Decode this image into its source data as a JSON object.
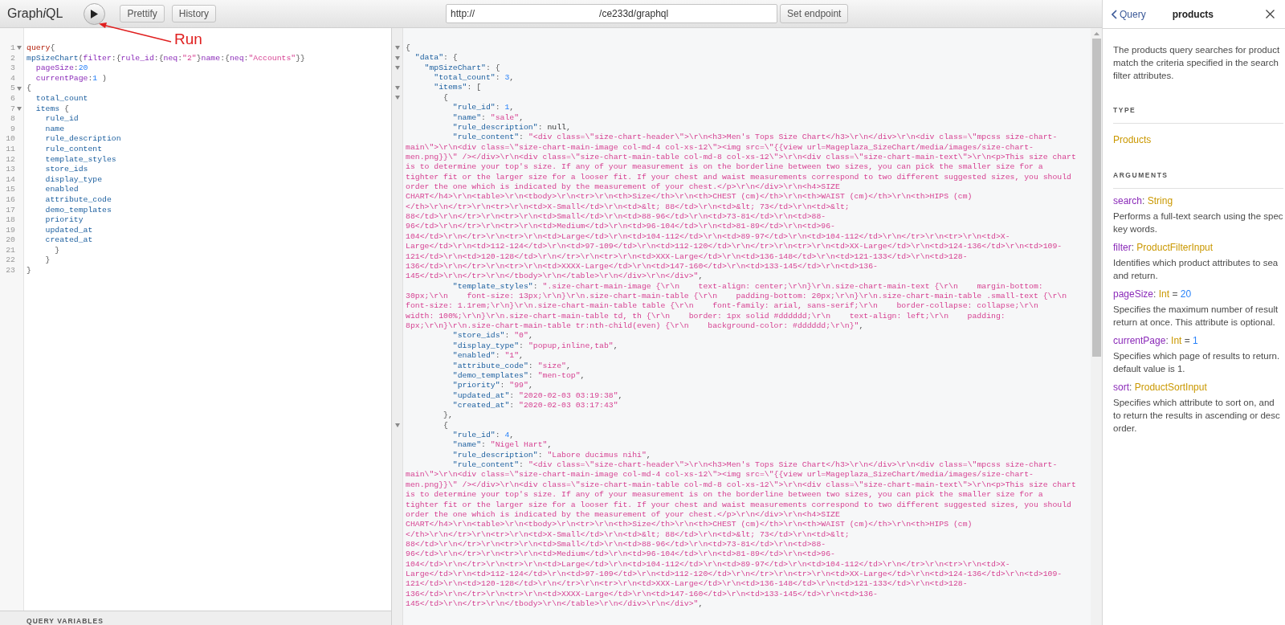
{
  "toolbar": {
    "title": [
      {
        "text": "Graph",
        "italic": false
      },
      {
        "text": "i",
        "italic": true
      },
      {
        "text": "QL",
        "italic": false
      }
    ],
    "buttons": [
      "Prettify",
      "History"
    ],
    "url": {
      "value": [
        "http://",
        "/ce233d/graphql"
      ]
    },
    "endpoint_button": "Set endpoint"
  },
  "annotation": {
    "label": "Run"
  },
  "query_editor": {
    "lines": [
      {
        "number": "1",
        "foldable": true,
        "tokens": [
          {
            "kind": "kw",
            "text": "query"
          },
          {
            "kind": "p",
            "text": "{"
          }
        ]
      },
      {
        "number": "2",
        "foldable": false,
        "tokens": [
          {
            "kind": "f",
            "text": "mpSizeChart"
          },
          {
            "kind": "p",
            "text": "("
          },
          {
            "kind": "a",
            "text": "filter"
          },
          {
            "kind": "p",
            "text": ":{"
          },
          {
            "kind": "a",
            "text": "rule_id"
          },
          {
            "kind": "p",
            "text": ":{"
          },
          {
            "kind": "a",
            "text": "neq"
          },
          {
            "kind": "p",
            "text": ":"
          },
          {
            "kind": "s",
            "text": "\"2\""
          },
          {
            "kind": "p",
            "text": "}"
          },
          {
            "kind": "a",
            "text": "name"
          },
          {
            "kind": "p",
            "text": ":{"
          },
          {
            "kind": "a",
            "text": "neq"
          },
          {
            "kind": "p",
            "text": ":"
          },
          {
            "kind": "s",
            "text": "\"Accounts\""
          },
          {
            "kind": "p",
            "text": "}}"
          }
        ]
      },
      {
        "number": "3",
        "foldable": false,
        "tokens": [
          {
            "kind": "a",
            "text": "  pageSize"
          },
          {
            "kind": "p",
            "text": ":"
          },
          {
            "kind": "n",
            "text": "20"
          }
        ]
      },
      {
        "number": "4",
        "foldable": false,
        "tokens": [
          {
            "kind": "a",
            "text": "  currentPage"
          },
          {
            "kind": "p",
            "text": ":"
          },
          {
            "kind": "n",
            "text": "1"
          },
          {
            "kind": "p",
            "text": " )"
          }
        ]
      },
      {
        "number": "5",
        "foldable": true,
        "tokens": [
          {
            "kind": "p",
            "text": "{"
          }
        ]
      },
      {
        "number": "6",
        "foldable": false,
        "tokens": [
          {
            "kind": "f",
            "text": "  total_count"
          }
        ]
      },
      {
        "number": "7",
        "foldable": true,
        "tokens": [
          {
            "kind": "f",
            "text": "  items"
          },
          {
            "kind": "p",
            "text": " {"
          }
        ]
      },
      {
        "number": "8",
        "foldable": false,
        "tokens": [
          {
            "kind": "f",
            "text": "    rule_id"
          }
        ]
      },
      {
        "number": "9",
        "foldable": false,
        "tokens": [
          {
            "kind": "f",
            "text": "    name"
          }
        ]
      },
      {
        "number": "10",
        "foldable": false,
        "tokens": [
          {
            "kind": "f",
            "text": "    rule_description"
          }
        ]
      },
      {
        "number": "11",
        "foldable": false,
        "tokens": [
          {
            "kind": "f",
            "text": "    rule_content"
          }
        ]
      },
      {
        "number": "12",
        "foldable": false,
        "tokens": [
          {
            "kind": "f",
            "text": "    template_styles"
          }
        ]
      },
      {
        "number": "13",
        "foldable": false,
        "tokens": [
          {
            "kind": "f",
            "text": "    store_ids"
          }
        ]
      },
      {
        "number": "14",
        "foldable": false,
        "tokens": [
          {
            "kind": "f",
            "text": "    display_type"
          }
        ]
      },
      {
        "number": "15",
        "foldable": false,
        "tokens": [
          {
            "kind": "f",
            "text": "    enabled"
          }
        ]
      },
      {
        "number": "16",
        "foldable": false,
        "tokens": [
          {
            "kind": "f",
            "text": "    attribute_code"
          }
        ]
      },
      {
        "number": "17",
        "foldable": false,
        "tokens": [
          {
            "kind": "f",
            "text": "    demo_templates"
          }
        ]
      },
      {
        "number": "18",
        "foldable": false,
        "tokens": [
          {
            "kind": "f",
            "text": "    priority"
          }
        ]
      },
      {
        "number": "19",
        "foldable": false,
        "tokens": [
          {
            "kind": "f",
            "text": "    updated_at"
          }
        ]
      },
      {
        "number": "20",
        "foldable": false,
        "tokens": [
          {
            "kind": "f",
            "text": "    created_at"
          }
        ]
      },
      {
        "number": "21",
        "foldable": false,
        "tokens": [
          {
            "kind": "p",
            "text": "      }"
          }
        ]
      },
      {
        "number": "22",
        "foldable": false,
        "tokens": [
          {
            "kind": "p",
            "text": "    }"
          }
        ]
      },
      {
        "number": "23",
        "foldable": false,
        "tokens": [
          {
            "kind": "p",
            "text": "}"
          }
        ]
      }
    ],
    "variables_title": "QUERY VARIABLES"
  },
  "result": {
    "lines": [
      {
        "foldable": true,
        "tokens": [
          {
            "kind": "p",
            "text": "{"
          }
        ]
      },
      {
        "foldable": true,
        "tokens": [
          {
            "kind": "k",
            "text": "  \"data\""
          },
          {
            "kind": "p",
            "text": ": {"
          }
        ]
      },
      {
        "foldable": true,
        "tokens": [
          {
            "kind": "k",
            "text": "    \"mpSizeChart\""
          },
          {
            "kind": "p",
            "text": ": {"
          }
        ]
      },
      {
        "foldable": false,
        "tokens": [
          {
            "kind": "k",
            "text": "      \"total_count\""
          },
          {
            "kind": "p",
            "text": ": "
          },
          {
            "kind": "n",
            "text": "3"
          },
          {
            "kind": "p",
            "text": ","
          }
        ]
      },
      {
        "foldable": true,
        "tokens": [
          {
            "kind": "k",
            "text": "      \"items\""
          },
          {
            "kind": "p",
            "text": ": ["
          }
        ]
      },
      {
        "foldable": true,
        "tokens": [
          {
            "kind": "p",
            "text": "        {"
          }
        ]
      },
      {
        "foldable": false,
        "tokens": [
          {
            "kind": "k",
            "text": "          \"rule_id\""
          },
          {
            "kind": "p",
            "text": ": "
          },
          {
            "kind": "n",
            "text": "1"
          },
          {
            "kind": "p",
            "text": ","
          }
        ]
      },
      {
        "foldable": false,
        "tokens": [
          {
            "kind": "k",
            "text": "          \"name\""
          },
          {
            "kind": "p",
            "text": ": "
          },
          {
            "kind": "s",
            "text": "\"sale\""
          },
          {
            "kind": "p",
            "text": ","
          }
        ]
      },
      {
        "foldable": false,
        "tokens": [
          {
            "kind": "k",
            "text": "          \"rule_description\""
          },
          {
            "kind": "p",
            "text": ": "
          },
          {
            "kind": "x",
            "text": "null"
          },
          {
            "kind": "p",
            "text": ","
          }
        ]
      },
      {
        "foldable": false,
        "tokens": [
          {
            "kind": "k",
            "text": "          \"rule_content\""
          },
          {
            "kind": "p",
            "text": ": "
          },
          {
            "kind": "s",
            "text": "\"<div class=\\\"size-chart-header\\\">\\r\\n<h3>Men's Tops Size Chart</h3>\\r\\n</div>\\r\\n<div class=\\\"mpcss size-chart-"
          }
        ]
      },
      {
        "foldable": false,
        "tokens": [
          {
            "kind": "s",
            "text": "main\\\">\\r\\n<div class=\\\"size-chart-main-image col-md-4 col-xs-12\\\"><img src=\\\"{{view url=Mageplaza_SizeChart/media/images/size-chart-"
          }
        ]
      },
      {
        "foldable": false,
        "tokens": [
          {
            "kind": "s",
            "text": "men.png}}\\\" /></div>\\r\\n<div class=\\\"size-chart-main-table col-md-8 col-xs-12\\\">\\r\\n<div class=\\\"size-chart-main-text\\\">\\r\\n<p>This size chart"
          }
        ]
      },
      {
        "foldable": false,
        "tokens": [
          {
            "kind": "s",
            "text": "is to determine your top's size. If any of your measurement is on the borderline between two sizes, you can pick the smaller size for a"
          }
        ]
      },
      {
        "foldable": false,
        "tokens": [
          {
            "kind": "s",
            "text": "tighter fit or the larger size for a looser fit. If your chest and waist measurements correspond to two different suggested sizes, you should"
          }
        ]
      },
      {
        "foldable": false,
        "tokens": [
          {
            "kind": "s",
            "text": "order the one which is indicated by the measurement of your chest.</p>\\r\\n</div>\\r\\n<h4>SIZE"
          }
        ]
      },
      {
        "foldable": false,
        "tokens": [
          {
            "kind": "s",
            "text": "CHART</h4>\\r\\n<table>\\r\\n<tbody>\\r\\n<tr>\\r\\n<th>Size</th>\\r\\n<th>CHEST (cm)</th>\\r\\n<th>WAIST (cm)</th>\\r\\n<th>HIPS (cm)"
          }
        ]
      },
      {
        "foldable": false,
        "tokens": [
          {
            "kind": "s",
            "text": "</th>\\r\\n</tr>\\r\\n<tr>\\r\\n<td>X-Small</td>\\r\\n<td>&lt; 88</td>\\r\\n<td>&lt; 73</td>\\r\\n<td>&lt;"
          }
        ]
      },
      {
        "foldable": false,
        "tokens": [
          {
            "kind": "s",
            "text": "88</td>\\r\\n</tr>\\r\\n<tr>\\r\\n<td>Small</td>\\r\\n<td>88-96</td>\\r\\n<td>73-81</td>\\r\\n<td>88-"
          }
        ]
      },
      {
        "foldable": false,
        "tokens": [
          {
            "kind": "s",
            "text": "96</td>\\r\\n</tr>\\r\\n<tr>\\r\\n<td>Medium</td>\\r\\n<td>96-104</td>\\r\\n<td>81-89</td>\\r\\n<td>96-"
          }
        ]
      },
      {
        "foldable": false,
        "tokens": [
          {
            "kind": "s",
            "text": "104</td>\\r\\n</tr>\\r\\n<tr>\\r\\n<td>Large</td>\\r\\n<td>104-112</td>\\r\\n<td>89-97</td>\\r\\n<td>104-112</td>\\r\\n</tr>\\r\\n<tr>\\r\\n<td>X-"
          }
        ]
      },
      {
        "foldable": false,
        "tokens": [
          {
            "kind": "s",
            "text": "Large</td>\\r\\n<td>112-124</td>\\r\\n<td>97-109</td>\\r\\n<td>112-120</td>\\r\\n</tr>\\r\\n<tr>\\r\\n<td>XX-Large</td>\\r\\n<td>124-136</td>\\r\\n<td>109-"
          }
        ]
      },
      {
        "foldable": false,
        "tokens": [
          {
            "kind": "s",
            "text": "121</td>\\r\\n<td>120-128</td>\\r\\n</tr>\\r\\n<tr>\\r\\n<td>XXX-Large</td>\\r\\n<td>136-148</td>\\r\\n<td>121-133</td>\\r\\n<td>128-"
          }
        ]
      },
      {
        "foldable": false,
        "tokens": [
          {
            "kind": "s",
            "text": "136</td>\\r\\n</tr>\\r\\n<tr>\\r\\n<td>XXXX-Large</td>\\r\\n<td>147-160</td>\\r\\n<td>133-145</td>\\r\\n<td>136-"
          }
        ]
      },
      {
        "foldable": false,
        "tokens": [
          {
            "kind": "s",
            "text": "145</td>\\r\\n</tr>\\r\\n</tbody>\\r\\n</table>\\r\\n</div>\\r\\n</div>\""
          },
          {
            "kind": "p",
            "text": ","
          }
        ]
      },
      {
        "foldable": false,
        "tokens": [
          {
            "kind": "k",
            "text": "          \"template_styles\""
          },
          {
            "kind": "p",
            "text": ": "
          },
          {
            "kind": "s",
            "text": "\".size-chart-main-image {\\r\\n    text-align: center;\\r\\n}\\r\\n.size-chart-main-text {\\r\\n    margin-bottom:"
          }
        ]
      },
      {
        "foldable": false,
        "tokens": [
          {
            "kind": "s",
            "text": "30px;\\r\\n    font-size: 13px;\\r\\n}\\r\\n.size-chart-main-table {\\r\\n    padding-bottom: 20px;\\r\\n}\\r\\n.size-chart-main-table .small-text {\\r\\n"
          }
        ]
      },
      {
        "foldable": false,
        "tokens": [
          {
            "kind": "s",
            "text": "font-size: 1.1rem;\\r\\n}\\r\\n.size-chart-main-table table {\\r\\n    font-family: arial, sans-serif;\\r\\n    border-collapse: collapse;\\r\\n"
          }
        ]
      },
      {
        "foldable": false,
        "tokens": [
          {
            "kind": "s",
            "text": "width: 100%;\\r\\n}\\r\\n.size-chart-main-table td, th {\\r\\n    border: 1px solid #dddddd;\\r\\n    text-align: left;\\r\\n    padding:"
          }
        ]
      },
      {
        "foldable": false,
        "tokens": [
          {
            "kind": "s",
            "text": "8px;\\r\\n}\\r\\n.size-chart-main-table tr:nth-child(even) {\\r\\n    background-color: #dddddd;\\r\\n}\""
          },
          {
            "kind": "p",
            "text": ","
          }
        ]
      },
      {
        "foldable": false,
        "tokens": [
          {
            "kind": "k",
            "text": "          \"store_ids\""
          },
          {
            "kind": "p",
            "text": ": "
          },
          {
            "kind": "s",
            "text": "\"0\""
          },
          {
            "kind": "p",
            "text": ","
          }
        ]
      },
      {
        "foldable": false,
        "tokens": [
          {
            "kind": "k",
            "text": "          \"display_type\""
          },
          {
            "kind": "p",
            "text": ": "
          },
          {
            "kind": "s",
            "text": "\"popup,inline,tab\""
          },
          {
            "kind": "p",
            "text": ","
          }
        ]
      },
      {
        "foldable": false,
        "tokens": [
          {
            "kind": "k",
            "text": "          \"enabled\""
          },
          {
            "kind": "p",
            "text": ": "
          },
          {
            "kind": "s",
            "text": "\"1\""
          },
          {
            "kind": "p",
            "text": ","
          }
        ]
      },
      {
        "foldable": false,
        "tokens": [
          {
            "kind": "k",
            "text": "          \"attribute_code\""
          },
          {
            "kind": "p",
            "text": ": "
          },
          {
            "kind": "s",
            "text": "\"size\""
          },
          {
            "kind": "p",
            "text": ","
          }
        ]
      },
      {
        "foldable": false,
        "tokens": [
          {
            "kind": "k",
            "text": "          \"demo_templates\""
          },
          {
            "kind": "p",
            "text": ": "
          },
          {
            "kind": "s",
            "text": "\"men-top\""
          },
          {
            "kind": "p",
            "text": ","
          }
        ]
      },
      {
        "foldable": false,
        "tokens": [
          {
            "kind": "k",
            "text": "          \"priority\""
          },
          {
            "kind": "p",
            "text": ": "
          },
          {
            "kind": "s",
            "text": "\"99\""
          },
          {
            "kind": "p",
            "text": ","
          }
        ]
      },
      {
        "foldable": false,
        "tokens": [
          {
            "kind": "k",
            "text": "          \"updated_at\""
          },
          {
            "kind": "p",
            "text": ": "
          },
          {
            "kind": "s",
            "text": "\"2020-02-03 03:19:38\""
          },
          {
            "kind": "p",
            "text": ","
          }
        ]
      },
      {
        "foldable": false,
        "tokens": [
          {
            "kind": "k",
            "text": "          \"created_at\""
          },
          {
            "kind": "p",
            "text": ": "
          },
          {
            "kind": "s",
            "text": "\"2020-02-03 03:17:43\""
          }
        ]
      },
      {
        "foldable": false,
        "tokens": [
          {
            "kind": "p",
            "text": "        },"
          }
        ]
      },
      {
        "foldable": true,
        "tokens": [
          {
            "kind": "p",
            "text": "        {"
          }
        ]
      },
      {
        "foldable": false,
        "tokens": [
          {
            "kind": "k",
            "text": "          \"rule_id\""
          },
          {
            "kind": "p",
            "text": ": "
          },
          {
            "kind": "n",
            "text": "4"
          },
          {
            "kind": "p",
            "text": ","
          }
        ]
      },
      {
        "foldable": false,
        "tokens": [
          {
            "kind": "k",
            "text": "          \"name\""
          },
          {
            "kind": "p",
            "text": ": "
          },
          {
            "kind": "s",
            "text": "\"Nigel Hart\""
          },
          {
            "kind": "p",
            "text": ","
          }
        ]
      },
      {
        "foldable": false,
        "tokens": [
          {
            "kind": "k",
            "text": "          \"rule_description\""
          },
          {
            "kind": "p",
            "text": ": "
          },
          {
            "kind": "s",
            "text": "\"Labore ducimus nihi\""
          },
          {
            "kind": "p",
            "text": ","
          }
        ]
      },
      {
        "foldable": false,
        "tokens": [
          {
            "kind": "k",
            "text": "          \"rule_content\""
          },
          {
            "kind": "p",
            "text": ": "
          },
          {
            "kind": "s",
            "text": "\"<div class=\\\"size-chart-header\\\">\\r\\n<h3>Men's Tops Size Chart</h3>\\r\\n</div>\\r\\n<div class=\\\"mpcss size-chart-"
          }
        ]
      },
      {
        "foldable": false,
        "tokens": [
          {
            "kind": "s",
            "text": "main\\\">\\r\\n<div class=\\\"size-chart-main-image col-md-4 col-xs-12\\\"><img src=\\\"{{view url=Mageplaza_SizeChart/media/images/size-chart-"
          }
        ]
      },
      {
        "foldable": false,
        "tokens": [
          {
            "kind": "s",
            "text": "men.png}}\\\" /></div>\\r\\n<div class=\\\"size-chart-main-table col-md-8 col-xs-12\\\">\\r\\n<div class=\\\"size-chart-main-text\\\">\\r\\n<p>This size chart"
          }
        ]
      },
      {
        "foldable": false,
        "tokens": [
          {
            "kind": "s",
            "text": "is to determine your top's size. If any of your measurement is on the borderline between two sizes, you can pick the smaller size for a"
          }
        ]
      },
      {
        "foldable": false,
        "tokens": [
          {
            "kind": "s",
            "text": "tighter fit or the larger size for a looser fit. If your chest and waist measurements correspond to two different suggested sizes, you should"
          }
        ]
      },
      {
        "foldable": false,
        "tokens": [
          {
            "kind": "s",
            "text": "order the one which is indicated by the measurement of your chest.</p>\\r\\n</div>\\r\\n<h4>SIZE"
          }
        ]
      },
      {
        "foldable": false,
        "tokens": [
          {
            "kind": "s",
            "text": "CHART</h4>\\r\\n<table>\\r\\n<tbody>\\r\\n<tr>\\r\\n<th>Size</th>\\r\\n<th>CHEST (cm)</th>\\r\\n<th>WAIST (cm)</th>\\r\\n<th>HIPS (cm)"
          }
        ]
      },
      {
        "foldable": false,
        "tokens": [
          {
            "kind": "s",
            "text": "</th>\\r\\n</tr>\\r\\n<tr>\\r\\n<td>X-Small</td>\\r\\n<td>&lt; 88</td>\\r\\n<td>&lt; 73</td>\\r\\n<td>&lt;"
          }
        ]
      },
      {
        "foldable": false,
        "tokens": [
          {
            "kind": "s",
            "text": "88</td>\\r\\n</tr>\\r\\n<tr>\\r\\n<td>Small</td>\\r\\n<td>88-96</td>\\r\\n<td>73-81</td>\\r\\n<td>88-"
          }
        ]
      },
      {
        "foldable": false,
        "tokens": [
          {
            "kind": "s",
            "text": "96</td>\\r\\n</tr>\\r\\n<tr>\\r\\n<td>Medium</td>\\r\\n<td>96-104</td>\\r\\n<td>81-89</td>\\r\\n<td>96-"
          }
        ]
      },
      {
        "foldable": false,
        "tokens": [
          {
            "kind": "s",
            "text": "104</td>\\r\\n</tr>\\r\\n<tr>\\r\\n<td>Large</td>\\r\\n<td>104-112</td>\\r\\n<td>89-97</td>\\r\\n<td>104-112</td>\\r\\n</tr>\\r\\n<tr>\\r\\n<td>X-"
          }
        ]
      },
      {
        "foldable": false,
        "tokens": [
          {
            "kind": "s",
            "text": "Large</td>\\r\\n<td>112-124</td>\\r\\n<td>97-109</td>\\r\\n<td>112-120</td>\\r\\n</tr>\\r\\n<tr>\\r\\n<td>XX-Large</td>\\r\\n<td>124-136</td>\\r\\n<td>109-"
          }
        ]
      },
      {
        "foldable": false,
        "tokens": [
          {
            "kind": "s",
            "text": "121</td>\\r\\n<td>120-128</td>\\r\\n</tr>\\r\\n<tr>\\r\\n<td>XXX-Large</td>\\r\\n<td>136-148</td>\\r\\n<td>121-133</td>\\r\\n<td>128-"
          }
        ]
      },
      {
        "foldable": false,
        "tokens": [
          {
            "kind": "s",
            "text": "136</td>\\r\\n</tr>\\r\\n<tr>\\r\\n<td>XXXX-Large</td>\\r\\n<td>147-160</td>\\r\\n<td>133-145</td>\\r\\n<td>136-"
          }
        ]
      },
      {
        "foldable": false,
        "tokens": [
          {
            "kind": "s",
            "text": "145</td>\\r\\n</tr>\\r\\n</tbody>\\r\\n</table>\\r\\n</div>\\r\\n</div>\""
          },
          {
            "kind": "p",
            "text": ","
          }
        ]
      }
    ]
  },
  "docs": {
    "back_link": "Query",
    "title": "products",
    "description": [
      "The products query searches for product",
      "match the criteria specified in the search",
      "filter attributes."
    ],
    "type_section": {
      "title": "TYPE",
      "link": "Products"
    },
    "arguments_title": "ARGUMENTS",
    "arguments": [
      {
        "name": "search",
        "colon": ":",
        "type": "String",
        "description": [
          "Performs a full-text search using the spec",
          "key words."
        ]
      },
      {
        "name": "filter",
        "colon": ":",
        "type": "ProductFilterInput",
        "description": [
          "Identifies which product attributes to sea",
          "and return."
        ]
      },
      {
        "name": "pageSize",
        "colon": ":",
        "type": "Int",
        "equals": "=",
        "default": "20",
        "description": [
          "Specifies the maximum number of result",
          "return at once. This attribute is optional."
        ]
      },
      {
        "name": "currentPage",
        "colon": ":",
        "type": "Int",
        "equals": "=",
        "default": "1",
        "description": [
          "Specifies which page of results to return.",
          "default value is 1."
        ]
      },
      {
        "name": "sort",
        "colon": ":",
        "type": "ProductSortInput",
        "description": [
          "Specifies which attribute to sort on, and",
          "to return the results in ascending or desc",
          "order."
        ]
      }
    ]
  }
}
